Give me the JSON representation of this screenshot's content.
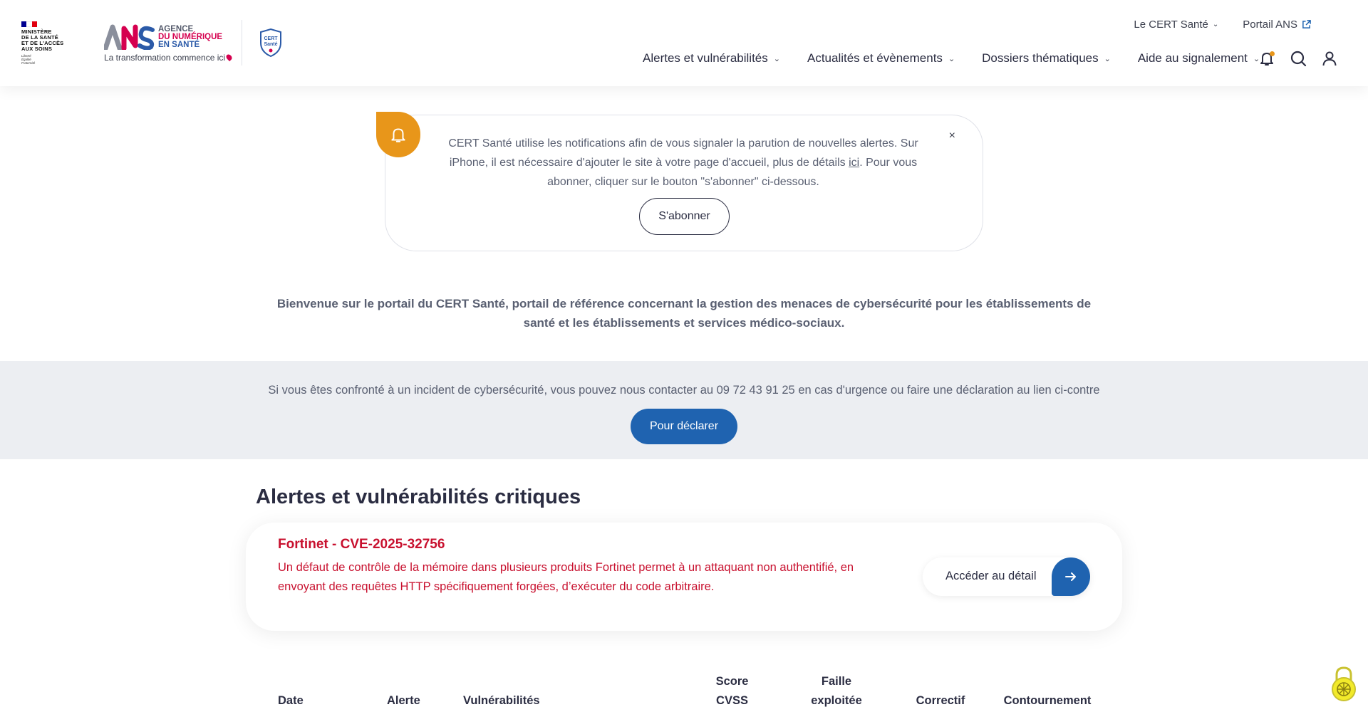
{
  "header": {
    "ministere_lines": [
      "MINISTÈRE",
      "DE LA SANTÉ",
      "ET DE L'ACCÈS",
      "AUX SOINS"
    ],
    "motto_lines": [
      "Liberté",
      "Égalité",
      "Fraternité"
    ],
    "ans_lines": [
      "AGENCE",
      "DU NUMÉRIQUE",
      "EN SANTÉ"
    ],
    "ans_tagline": "La transformation commence ici",
    "cert_logo_lines": [
      "CERT",
      "Santé"
    ],
    "top_links": [
      {
        "label": "Le CERT Santé"
      },
      {
        "label": "Portail ANS"
      }
    ],
    "nav": [
      {
        "label": "Alertes et vulnérabilités"
      },
      {
        "label": "Actualités et évènements"
      },
      {
        "label": "Dossiers thématiques"
      },
      {
        "label": "Aide au signalement"
      }
    ],
    "icons": [
      "bell-icon",
      "search-icon",
      "user-icon"
    ],
    "colors": {
      "flag_blue": "#000091",
      "flag_red": "#e1000f",
      "ans_pink": "#d5004f",
      "ans_blue": "#2b5aa8",
      "notif_dot": "#e8961a"
    }
  },
  "notification": {
    "text_before": "CERT Santé utilise les notifications afin de vous signaler la parution de nouvelles alertes. Sur iPhone, il est nécessaire d'ajouter le site à votre page d'accueil, plus de détails ",
    "link": "ici",
    "text_after": ". Pour vous abonner, cliquer sur le bouton \"s'abonner\" ci-dessous.",
    "close": "×",
    "subscribe_label": "S'abonner"
  },
  "welcome": "Bienvenue sur le portail du CERT Santé, portail de référence concernant la gestion des menaces de cybersécurité pour les établissements de santé et les établissements et services médico-sociaux.",
  "contact": {
    "text": "Si vous êtes confronté à un incident de cybersécurité, vous pouvez nous contacter au 09 72 43 91 25 en cas d'urgence ou faire une déclaration au lien ci-contre",
    "button": "Pour déclarer"
  },
  "alerts": {
    "title": "Alertes et vulnérabilités critiques",
    "card": {
      "title": "Fortinet - CVE-2025-32756",
      "description": "Un défaut de contrôle de la mémoire dans plusieurs produits Fortinet permet à un attaquant non authentifié, en envoyant des requêtes HTTP spécifiquement forgées, d’exécuter du code arbitraire.",
      "button": "Accéder au détail"
    }
  },
  "table": {
    "headers": [
      {
        "line1": "",
        "line2": "Date"
      },
      {
        "line1": "",
        "line2": "Alerte"
      },
      {
        "line1": "",
        "line2": "Vulnérabilités"
      },
      {
        "line1": "Score",
        "line2": "CVSS"
      },
      {
        "line1": "Faille",
        "line2": "exploitée"
      },
      {
        "line1": "",
        "line2": "Correctif"
      },
      {
        "line1": "",
        "line2": "Contournement"
      }
    ]
  },
  "accessibility_button": "accessibility-icon"
}
